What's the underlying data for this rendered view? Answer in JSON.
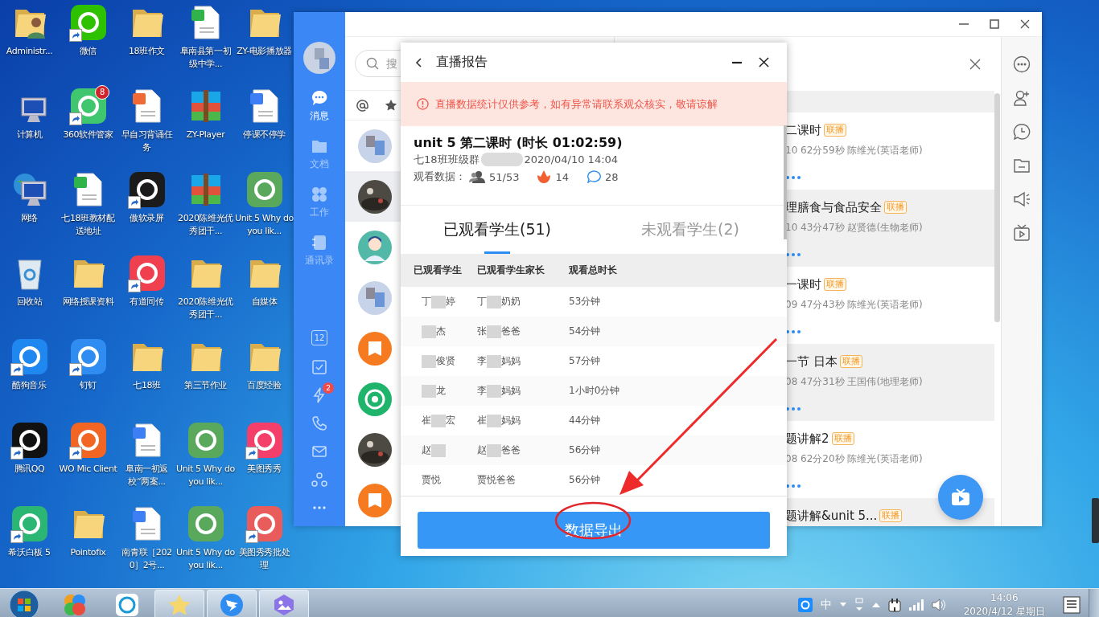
{
  "desktop": {
    "rows": [
      {
        "icons": [
          {
            "label": "Administr...",
            "kind": "user",
            "shortcut": false
          },
          {
            "label": "微信",
            "kind": "app",
            "color": "#2dc100",
            "shortcut": true
          },
          {
            "label": "18班作文",
            "kind": "folder",
            "shortcut": false
          },
          {
            "label": "阜南县第一初级中学...",
            "kind": "sheet",
            "shortcut": false
          },
          {
            "label": "ZY-电影播放器",
            "kind": "folder",
            "shortcut": false
          }
        ]
      },
      {
        "icons": [
          {
            "label": "计算机",
            "kind": "computer",
            "shortcut": false
          },
          {
            "label": "360软件管家",
            "kind": "app",
            "color": "#3fc66e",
            "shortcut": true,
            "badge": "8"
          },
          {
            "label": "早自习背诵任务",
            "kind": "slides",
            "shortcut": false
          },
          {
            "label": "ZY-Player",
            "kind": "archive",
            "shortcut": false
          },
          {
            "label": "停课不停学",
            "kind": "doc",
            "shortcut": false
          }
        ]
      },
      {
        "icons": [
          {
            "label": "网络",
            "kind": "network",
            "shortcut": false
          },
          {
            "label": "七18班教材配送地址",
            "kind": "sheet",
            "shortcut": false
          },
          {
            "label": "傲软录屏",
            "kind": "app",
            "color": "#1b1b1b",
            "shortcut": true
          },
          {
            "label": "2020陈维光优秀团干...",
            "kind": "archive",
            "shortcut": false
          },
          {
            "label": "Unit 5 Why do you lik...",
            "kind": "app",
            "color": "#5aa85c",
            "shortcut": false
          }
        ]
      },
      {
        "icons": [
          {
            "label": "回收站",
            "kind": "recycle",
            "shortcut": false
          },
          {
            "label": "网络授课资料",
            "kind": "folder",
            "shortcut": false
          },
          {
            "label": "有道同传",
            "kind": "app",
            "color": "#f0404f",
            "shortcut": true
          },
          {
            "label": "2020陈维光优秀团干...",
            "kind": "folder",
            "shortcut": false
          },
          {
            "label": "自媒体",
            "kind": "folder",
            "shortcut": false
          }
        ]
      },
      {
        "icons": [
          {
            "label": "酷狗音乐",
            "kind": "app",
            "color": "#1e88f0",
            "shortcut": true
          },
          {
            "label": "钉钉",
            "kind": "app",
            "color": "#2f8cf0",
            "shortcut": true
          },
          {
            "label": "七18班",
            "kind": "folder",
            "shortcut": false
          },
          {
            "label": "第三节作业",
            "kind": "folder",
            "shortcut": false
          },
          {
            "label": "百度经验",
            "kind": "folder",
            "shortcut": false
          }
        ]
      },
      {
        "icons": [
          {
            "label": "腾讯QQ",
            "kind": "app",
            "color": "#111111",
            "shortcut": true
          },
          {
            "label": "WO Mic Client",
            "kind": "app",
            "color": "#f26522",
            "shortcut": true
          },
          {
            "label": "阜南一初返校“两案...",
            "kind": "doc",
            "shortcut": false
          },
          {
            "label": "Unit 5 Why do you lik...",
            "kind": "app",
            "color": "#5aa85c",
            "shortcut": false
          },
          {
            "label": "美图秀秀",
            "kind": "app",
            "color": "#f43f6a",
            "shortcut": true
          }
        ]
      },
      {
        "icons": [
          {
            "label": "希沃白板 5",
            "kind": "app",
            "color": "#2bb673",
            "shortcut": true
          },
          {
            "label": "Pointofix",
            "kind": "folder",
            "shortcut": false
          },
          {
            "label": "南青联［2020］2号...",
            "kind": "doc",
            "shortcut": false
          },
          {
            "label": "Unit 5 Why do you lik...",
            "kind": "app",
            "color": "#5aa85c",
            "shortcut": false
          },
          {
            "label": "美图秀秀批处理",
            "kind": "app",
            "color": "#e85c5c",
            "shortcut": true
          }
        ]
      }
    ]
  },
  "app_window": {
    "nav": [
      {
        "label": "消息",
        "selected": true
      },
      {
        "label": "文档",
        "selected": false
      },
      {
        "label": "工作",
        "selected": false
      },
      {
        "label": "通讯录",
        "selected": false
      }
    ],
    "tools": [
      {
        "kind": "calendar",
        "text": "12"
      },
      {
        "kind": "check"
      },
      {
        "kind": "lightning",
        "badge": "2"
      },
      {
        "kind": "phone"
      },
      {
        "kind": "mail"
      },
      {
        "kind": "group"
      },
      {
        "kind": "more"
      }
    ],
    "search": {
      "placeholder": "搜"
    },
    "chats": [
      {
        "kind": "mosaic",
        "selected": false
      },
      {
        "kind": "photo",
        "selected": true
      },
      {
        "kind": "person",
        "selected": false
      },
      {
        "kind": "mosaic",
        "selected": false
      },
      {
        "kind": "book",
        "selected": false
      },
      {
        "kind": "target",
        "selected": false
      },
      {
        "kind": "photo",
        "selected": false
      },
      {
        "kind": "book",
        "selected": false
      }
    ],
    "lives": [
      {
        "title": "二课时",
        "tag": "联播",
        "meta": "10 62分59秒 陈维光(英语老师)"
      },
      {
        "title": "理膳食与食品安全",
        "tag": "联播",
        "meta": "10 43分47秒 赵贤德(生物老师)"
      },
      {
        "title": "一课时",
        "tag": "联播",
        "meta": "09 47分43秒 陈维光(英语老师)"
      },
      {
        "title": "一节 日本",
        "tag": "联播",
        "meta": "08 47分31秒 王国伟(地理老师)"
      },
      {
        "title": "题讲解2",
        "tag": "联播",
        "meta": "08 62分20秒 陈维光(英语老师)"
      },
      {
        "title": "题讲解&unit 5...",
        "tag": "联播"
      }
    ]
  },
  "dialog": {
    "title": "直播报告",
    "notice": "直播数据统计仅供参考，如有异常请联系观众核实，敬请谅解",
    "lesson_title": "unit 5 第二课时 (时长 01:02:59)",
    "group": "七18班班级群",
    "time": "2020/04/10 14:04",
    "stats_label": "观看数据：",
    "stats": [
      {
        "kind": "viewers",
        "value": "51/53"
      },
      {
        "kind": "flowers",
        "value": "14"
      },
      {
        "kind": "comments",
        "value": "28"
      }
    ],
    "tabs": [
      {
        "label": "已观看学生(51)",
        "selected": true
      },
      {
        "label": "未观看学生(2)",
        "selected": false
      }
    ],
    "columns": [
      "已观看学生",
      "已观看学生家长",
      "观看总时长"
    ],
    "rows": [
      {
        "student": {
          "before": "丁",
          "blurred": true,
          "after": "婷"
        },
        "parent": {
          "before": "丁",
          "blurred": true,
          "after": "奶奶"
        },
        "duration": "53分钟"
      },
      {
        "student": {
          "blurred": true,
          "after": "杰"
        },
        "parent": {
          "before": "张",
          "blurred": true,
          "after": "爸爸"
        },
        "duration": "54分钟"
      },
      {
        "student": {
          "blurred": true,
          "after": "俊贤"
        },
        "parent": {
          "before": "李",
          "blurred": true,
          "after": "妈妈"
        },
        "duration": "57分钟"
      },
      {
        "student": {
          "blurred": true,
          "after": "龙"
        },
        "parent": {
          "before": "李",
          "blurred": true,
          "after": "妈妈"
        },
        "duration": "1小时0分钟"
      },
      {
        "student": {
          "before": "崔",
          "blurred": true,
          "after": "宏"
        },
        "parent": {
          "before": "崔",
          "blurred": true,
          "after": "妈妈"
        },
        "duration": "44分钟"
      },
      {
        "student": {
          "before": "赵",
          "blurred": true
        },
        "parent": {
          "before": "赵",
          "blurred": true,
          "after": "爸爸"
        },
        "duration": "56分钟"
      },
      {
        "student": {
          "before": "贾悦",
          "blurred": false
        },
        "parent": {
          "before": "贾悦爸爸",
          "blurred": false
        },
        "duration": "56分钟"
      }
    ],
    "export_button": "数据导出"
  },
  "taskbar": {
    "apps": [
      {
        "kind": "multicolor",
        "open": false
      },
      {
        "kind": "v",
        "open": false
      },
      {
        "kind": "star",
        "open": true
      },
      {
        "kind": "dingtalk",
        "open": true
      },
      {
        "kind": "photos",
        "open": true
      }
    ],
    "ime": "中",
    "time": "14:06",
    "date": "2020/4/12 星期日"
  }
}
